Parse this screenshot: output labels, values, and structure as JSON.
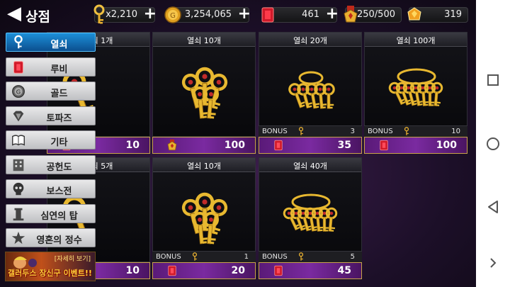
{
  "header": {
    "back_glyph": "◀",
    "title": "상점",
    "currencies": [
      {
        "icon": "key-icon",
        "value": "x2,210",
        "plus": "+"
      },
      {
        "icon": "gold-coin-icon",
        "value": "3,254,065",
        "plus": "+"
      },
      {
        "icon": "ruby-icon",
        "value": "461",
        "plus": "+"
      },
      {
        "icon": "medal-icon",
        "value": "250/500"
      },
      {
        "icon": "topaz-icon",
        "value": "319"
      }
    ]
  },
  "sidebar": {
    "items": [
      {
        "icon": "key-icon",
        "label": "열쇠",
        "active": true
      },
      {
        "icon": "ruby-icon",
        "label": "루비"
      },
      {
        "icon": "gold-coin-icon",
        "label": "골드"
      },
      {
        "icon": "diamond-icon",
        "label": "토파즈"
      },
      {
        "icon": "book-icon",
        "label": "기타"
      },
      {
        "icon": "building-icon",
        "label": "공헌도"
      },
      {
        "icon": "skull-icon",
        "label": "보스전"
      },
      {
        "icon": "tower-icon",
        "label": "심연의 탑"
      },
      {
        "icon": "star-icon",
        "label": "영혼의 정수"
      }
    ],
    "banner": {
      "top": "[자세히 보기]",
      "main": "갤러두스 장신구 이벤트!!"
    }
  },
  "cards": [
    {
      "title": "열쇠 1개",
      "art": "single-key",
      "price_icon": "ruby-icon",
      "price": "10"
    },
    {
      "title": "열쇠 10개",
      "art": "key-bundle",
      "price_icon": "medal-icon",
      "price": "100"
    },
    {
      "title": "열쇠 20개",
      "art": "key-ring",
      "bonus_label": "BONUS",
      "bonus": "3",
      "price_icon": "ruby-icon",
      "price": "35"
    },
    {
      "title": "열쇠 100개",
      "art": "key-pile",
      "bonus_label": "BONUS",
      "bonus": "10",
      "price_icon": "ruby-icon",
      "price": "100"
    },
    {
      "title": "열쇠 5개",
      "art": "single-key",
      "price_icon": "ruby-icon",
      "price": "10"
    },
    {
      "title": "열쇠 10개",
      "art": "key-bundle",
      "bonus_label": "BONUS",
      "bonus": "1",
      "price_icon": "ruby-icon",
      "price": "20"
    },
    {
      "title": "열쇠 40개",
      "art": "key-pile",
      "bonus_label": "BONUS",
      "bonus": "5",
      "price_icon": "ruby-icon",
      "price": "45"
    }
  ],
  "nav": {
    "buttons": [
      "recents-icon",
      "home-icon",
      "back-icon",
      "chevron-right-icon"
    ]
  },
  "colors": {
    "accent": "#1d8fd8",
    "price_bg": "#7a2aa0",
    "gold": "#e8b830"
  }
}
